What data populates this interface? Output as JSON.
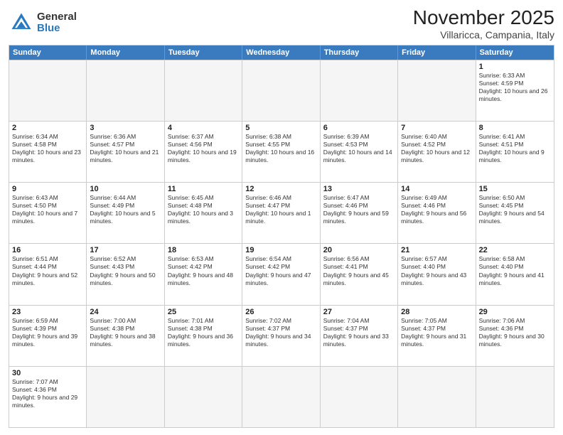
{
  "logo": {
    "general": "General",
    "blue": "Blue"
  },
  "title": "November 2025",
  "subtitle": "Villaricca, Campania, Italy",
  "weekdays": [
    "Sunday",
    "Monday",
    "Tuesday",
    "Wednesday",
    "Thursday",
    "Friday",
    "Saturday"
  ],
  "weeks": [
    [
      {
        "day": "",
        "info": "",
        "empty": true
      },
      {
        "day": "",
        "info": "",
        "empty": true
      },
      {
        "day": "",
        "info": "",
        "empty": true
      },
      {
        "day": "",
        "info": "",
        "empty": true
      },
      {
        "day": "",
        "info": "",
        "empty": true
      },
      {
        "day": "",
        "info": "",
        "empty": true
      },
      {
        "day": "1",
        "info": "Sunrise: 6:33 AM\nSunset: 4:59 PM\nDaylight: 10 hours and 26 minutes."
      }
    ],
    [
      {
        "day": "2",
        "info": "Sunrise: 6:34 AM\nSunset: 4:58 PM\nDaylight: 10 hours and 23 minutes."
      },
      {
        "day": "3",
        "info": "Sunrise: 6:36 AM\nSunset: 4:57 PM\nDaylight: 10 hours and 21 minutes."
      },
      {
        "day": "4",
        "info": "Sunrise: 6:37 AM\nSunset: 4:56 PM\nDaylight: 10 hours and 19 minutes."
      },
      {
        "day": "5",
        "info": "Sunrise: 6:38 AM\nSunset: 4:55 PM\nDaylight: 10 hours and 16 minutes."
      },
      {
        "day": "6",
        "info": "Sunrise: 6:39 AM\nSunset: 4:53 PM\nDaylight: 10 hours and 14 minutes."
      },
      {
        "day": "7",
        "info": "Sunrise: 6:40 AM\nSunset: 4:52 PM\nDaylight: 10 hours and 12 minutes."
      },
      {
        "day": "8",
        "info": "Sunrise: 6:41 AM\nSunset: 4:51 PM\nDaylight: 10 hours and 9 minutes."
      }
    ],
    [
      {
        "day": "9",
        "info": "Sunrise: 6:43 AM\nSunset: 4:50 PM\nDaylight: 10 hours and 7 minutes."
      },
      {
        "day": "10",
        "info": "Sunrise: 6:44 AM\nSunset: 4:49 PM\nDaylight: 10 hours and 5 minutes."
      },
      {
        "day": "11",
        "info": "Sunrise: 6:45 AM\nSunset: 4:48 PM\nDaylight: 10 hours and 3 minutes."
      },
      {
        "day": "12",
        "info": "Sunrise: 6:46 AM\nSunset: 4:47 PM\nDaylight: 10 hours and 1 minute."
      },
      {
        "day": "13",
        "info": "Sunrise: 6:47 AM\nSunset: 4:46 PM\nDaylight: 9 hours and 59 minutes."
      },
      {
        "day": "14",
        "info": "Sunrise: 6:49 AM\nSunset: 4:46 PM\nDaylight: 9 hours and 56 minutes."
      },
      {
        "day": "15",
        "info": "Sunrise: 6:50 AM\nSunset: 4:45 PM\nDaylight: 9 hours and 54 minutes."
      }
    ],
    [
      {
        "day": "16",
        "info": "Sunrise: 6:51 AM\nSunset: 4:44 PM\nDaylight: 9 hours and 52 minutes."
      },
      {
        "day": "17",
        "info": "Sunrise: 6:52 AM\nSunset: 4:43 PM\nDaylight: 9 hours and 50 minutes."
      },
      {
        "day": "18",
        "info": "Sunrise: 6:53 AM\nSunset: 4:42 PM\nDaylight: 9 hours and 48 minutes."
      },
      {
        "day": "19",
        "info": "Sunrise: 6:54 AM\nSunset: 4:42 PM\nDaylight: 9 hours and 47 minutes."
      },
      {
        "day": "20",
        "info": "Sunrise: 6:56 AM\nSunset: 4:41 PM\nDaylight: 9 hours and 45 minutes."
      },
      {
        "day": "21",
        "info": "Sunrise: 6:57 AM\nSunset: 4:40 PM\nDaylight: 9 hours and 43 minutes."
      },
      {
        "day": "22",
        "info": "Sunrise: 6:58 AM\nSunset: 4:40 PM\nDaylight: 9 hours and 41 minutes."
      }
    ],
    [
      {
        "day": "23",
        "info": "Sunrise: 6:59 AM\nSunset: 4:39 PM\nDaylight: 9 hours and 39 minutes."
      },
      {
        "day": "24",
        "info": "Sunrise: 7:00 AM\nSunset: 4:38 PM\nDaylight: 9 hours and 38 minutes."
      },
      {
        "day": "25",
        "info": "Sunrise: 7:01 AM\nSunset: 4:38 PM\nDaylight: 9 hours and 36 minutes."
      },
      {
        "day": "26",
        "info": "Sunrise: 7:02 AM\nSunset: 4:37 PM\nDaylight: 9 hours and 34 minutes."
      },
      {
        "day": "27",
        "info": "Sunrise: 7:04 AM\nSunset: 4:37 PM\nDaylight: 9 hours and 33 minutes."
      },
      {
        "day": "28",
        "info": "Sunrise: 7:05 AM\nSunset: 4:37 PM\nDaylight: 9 hours and 31 minutes."
      },
      {
        "day": "29",
        "info": "Sunrise: 7:06 AM\nSunset: 4:36 PM\nDaylight: 9 hours and 30 minutes."
      }
    ],
    [
      {
        "day": "30",
        "info": "Sunrise: 7:07 AM\nSunset: 4:36 PM\nDaylight: 9 hours and 29 minutes."
      },
      {
        "day": "",
        "info": "",
        "empty": true
      },
      {
        "day": "",
        "info": "",
        "empty": true
      },
      {
        "day": "",
        "info": "",
        "empty": true
      },
      {
        "day": "",
        "info": "",
        "empty": true
      },
      {
        "day": "",
        "info": "",
        "empty": true
      },
      {
        "day": "",
        "info": "",
        "empty": true
      }
    ]
  ]
}
